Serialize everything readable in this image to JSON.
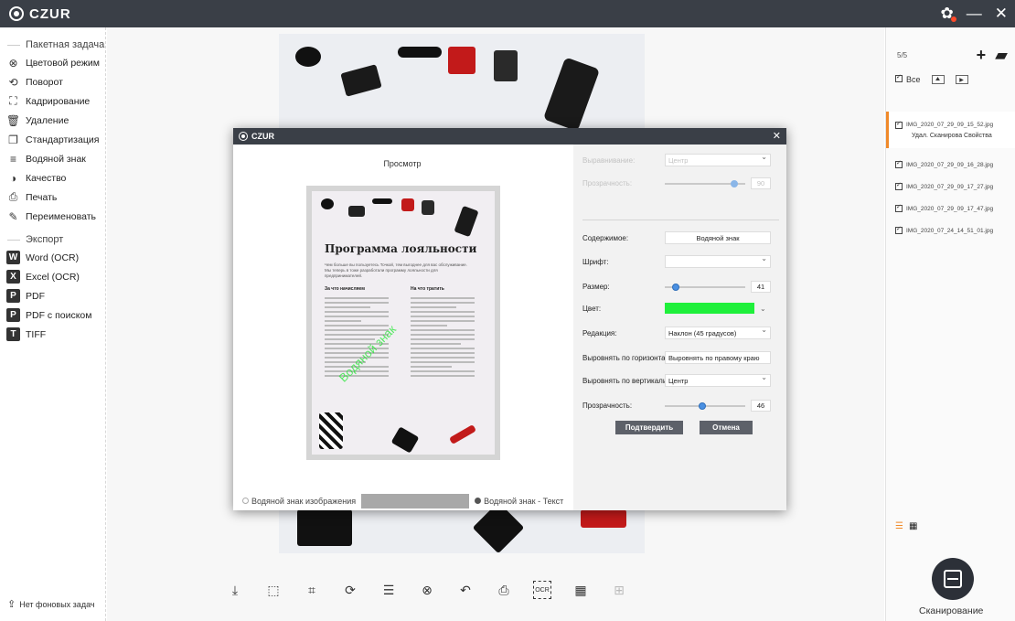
{
  "app": {
    "title": "CZUR"
  },
  "left": {
    "batch_title": "Пакетная задача",
    "items": [
      {
        "label": "Цветовой режим",
        "icon": "color-mode-icon",
        "glyph": "⊗"
      },
      {
        "label": "Поворот",
        "icon": "rotate-icon",
        "glyph": "⟲"
      },
      {
        "label": "Кадрирование",
        "icon": "crop-icon",
        "glyph": "⛶"
      },
      {
        "label": "Удаление",
        "icon": "delete-icon",
        "glyph": "🗑"
      },
      {
        "label": "Стандартизация",
        "icon": "standardize-icon",
        "glyph": "❐"
      },
      {
        "label": "Водяной знак",
        "icon": "watermark-icon",
        "glyph": "≡"
      },
      {
        "label": "Качество",
        "icon": "quality-icon",
        "glyph": "◑"
      },
      {
        "label": "Печать",
        "icon": "print-icon",
        "glyph": "⎙"
      },
      {
        "label": "Переименовать",
        "icon": "rename-icon",
        "glyph": "✎"
      }
    ],
    "export_title": "Экспорт",
    "export_items": [
      {
        "label": "Word (OCR)",
        "icon": "word-icon",
        "glyph": "W"
      },
      {
        "label": "Excel (OCR)",
        "icon": "excel-icon",
        "glyph": "X"
      },
      {
        "label": "PDF",
        "icon": "pdf-icon",
        "glyph": "P"
      },
      {
        "label": "PDF с поиском",
        "icon": "pdf-search-icon",
        "glyph": "P"
      },
      {
        "label": "TIFF",
        "icon": "tiff-icon",
        "glyph": "T"
      }
    ],
    "footer": "Нет фоновых задач"
  },
  "dialog": {
    "title": "CZUR",
    "preview_label": "Просмотр",
    "doc_title": "Программа лояльности",
    "doc_intro": "Чем больше вы пользуетесь Точкой, тем выгоднее для вас обслуживание. Мы теперь в тоже разработали программу лояльности для предпринимателей.",
    "doc_col1": "За что начисляем",
    "doc_col2": "На что тратить",
    "watermark_preview": "Водяной знак",
    "image_wm_label": "Водяной знак изображения",
    "text_wm_label": "Водяной знак - Текст",
    "fields": {
      "align_label": "Выравнивание:",
      "align_value": "Центр",
      "opacity1_label": "Прозрачность:",
      "opacity1_value": 90,
      "content_label": "Содержимое:",
      "content_value": "Водяной знак",
      "font_label": "Шрифт:",
      "font_value": "",
      "size_label": "Размер:",
      "size_value": 41,
      "color_label": "Цвет:",
      "color_value": "#1ff03b",
      "edit_label": "Редакция:",
      "edit_value": "Наклон (45 градусов)",
      "halign_label": "Выровнять по горизонтали:",
      "halign_value": "Выровнять по правому краю",
      "valign_label": "Выровнять по вертикали:",
      "valign_value": "Центр",
      "opacity2_label": "Прозрачность:",
      "opacity2_value": 46
    },
    "confirm_label": "Подтвердить",
    "cancel_label": "Отмена"
  },
  "right": {
    "count": "5/5",
    "select_all": "Все",
    "files": [
      {
        "name": "IMG_2020_07_29_09_15_52.jpg",
        "active": true
      },
      {
        "name": "IMG_2020_07_29_09_16_28.jpg"
      },
      {
        "name": "IMG_2020_07_29_09_17_27.jpg"
      },
      {
        "name": "IMG_2020_07_29_09_17_47.jpg"
      },
      {
        "name": "IMG_2020_07_24_14_51_01.jpg"
      }
    ],
    "file_actions": "Удал. Сканирова Свойства",
    "scan_label": "Сканирование"
  },
  "toolbar_icons": [
    "fit-icon",
    "select-icon",
    "crop-icon",
    "rotate-icon",
    "adjust-icon",
    "color-icon",
    "undo-icon",
    "print-icon",
    "ocr-icon",
    "qr-icon",
    "split-icon"
  ],
  "colors": {
    "accent": "#f08a2a",
    "titlebar": "#3a3f47",
    "slider": "#4a90e2"
  }
}
